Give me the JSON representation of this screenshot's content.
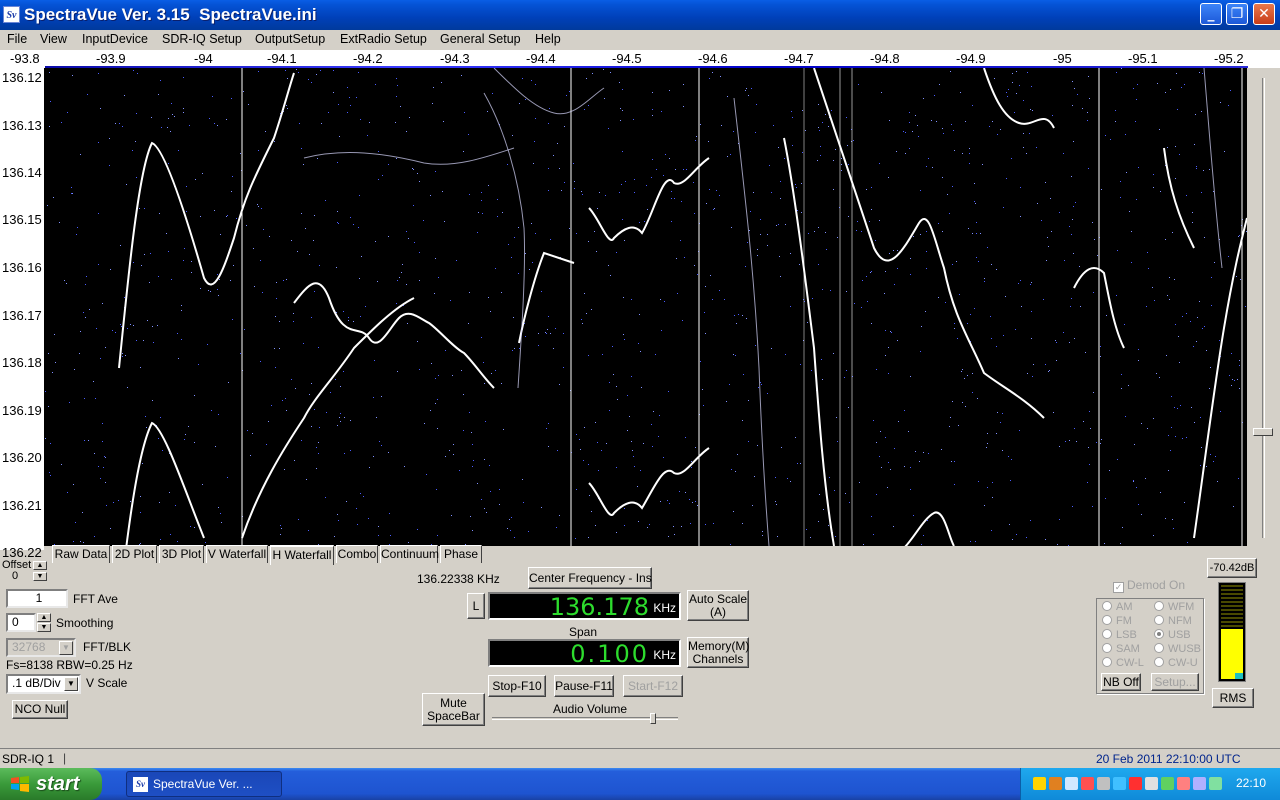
{
  "window": {
    "icon_text": "Sv",
    "title": "SpectraVue Ver. 3.15  SpectraVue.ini",
    "min": "_",
    "max": "❐",
    "close": "✕"
  },
  "menu": [
    "File",
    "View",
    "InputDevice",
    "SDR-IQ Setup",
    "OutputSetup",
    "ExtRadio Setup",
    "General Setup",
    "Help"
  ],
  "freq_axis": [
    "-93.8",
    "-93.9",
    "-94",
    "-94.1",
    "-94.2",
    "-94.3",
    "-94.4",
    "-94.5",
    "-94.6",
    "-94.7",
    "-94.8",
    "-94.9",
    "-95",
    "-95.1",
    "-95.2"
  ],
  "time_axis": [
    "136.12",
    "136.13",
    "136.14",
    "136.15",
    "136.16",
    "136.17",
    "136.18",
    "136.19",
    "136.20",
    "136.21",
    "136.22"
  ],
  "tabs": [
    "Raw Data",
    "2D Plot",
    "3D Plot",
    "V Waterfall",
    "H Waterfall",
    "Combo",
    "Continuum",
    "Phase"
  ],
  "active_tab": "H Waterfall",
  "left_panel": {
    "offset_label": "Offset",
    "offset_value": "0",
    "fft_ave_value": "1",
    "fft_ave_label": "FFT Ave",
    "smoothing_value": "0",
    "smoothing_label": "Smoothing",
    "fft_blk_value": "32768",
    "fft_blk_label": "FFT/BLK",
    "fs_info": "Fs=8138 RBW=0.25 Hz",
    "vscale_value": ".1 dB/Div",
    "vscale_label": "V Scale",
    "nco_null": "NCO Null"
  },
  "center": {
    "cursor_freq": "136.22338 KHz",
    "center_freq_button": "Center Frequency - Ins",
    "l_button": "L",
    "freq_value": "136.178",
    "freq_unit": "KHz",
    "auto_scale_line1": "Auto Scale",
    "auto_scale_line2": "(A)",
    "span_label": "Span",
    "span_value": "0.100",
    "span_unit": "KHz",
    "memory_line1": "Memory(M)",
    "memory_line2": "Channels",
    "mute_line1": "Mute",
    "mute_line2": "SpaceBar",
    "stop": "Stop-F10",
    "pause": "Pause-F11",
    "start": "Start-F12",
    "audio_volume": "Audio Volume"
  },
  "right_panel": {
    "demod_on": "Demod On",
    "modes_left": [
      "AM",
      "FM",
      "LSB",
      "SAM",
      "CW-L"
    ],
    "modes_right": [
      "WFM",
      "NFM",
      "USB",
      "WUSB",
      "CW-U"
    ],
    "selected_mode": "USB",
    "nb_off": "NB Off",
    "setup": "Setup...",
    "level": "-70.42dB",
    "meter_fill_fraction": 0.55,
    "rms": "RMS"
  },
  "status": {
    "device": "SDR-IQ 1",
    "datetime": "20 Feb 2011   22:10:00  UTC"
  },
  "taskbar": {
    "start": "start",
    "task": "SpectraVue Ver. ...",
    "clock": "22:10"
  }
}
